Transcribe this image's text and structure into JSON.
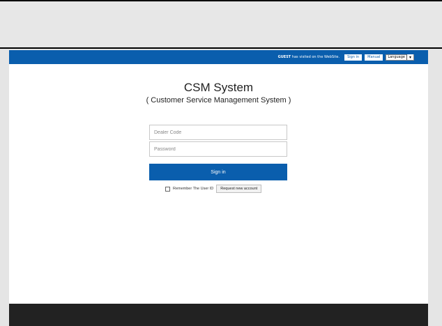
{
  "topbar": {
    "visitor_name": "GUEST",
    "visitor_text": "has visited on the WebSite.",
    "signin_label": "Sign in",
    "manual_label": "Manual",
    "language_label": "Language"
  },
  "login": {
    "title": "CSM System",
    "subtitle": "( Customer Service Management System )",
    "dealer_placeholder": "Dealer Code",
    "password_placeholder": "Password",
    "signin_label": "Sign in",
    "remember_label": "Remember The User ID",
    "request_label": "Request new account"
  },
  "colors": {
    "brand_blue": "#0a5ead",
    "footer": "#222222"
  }
}
